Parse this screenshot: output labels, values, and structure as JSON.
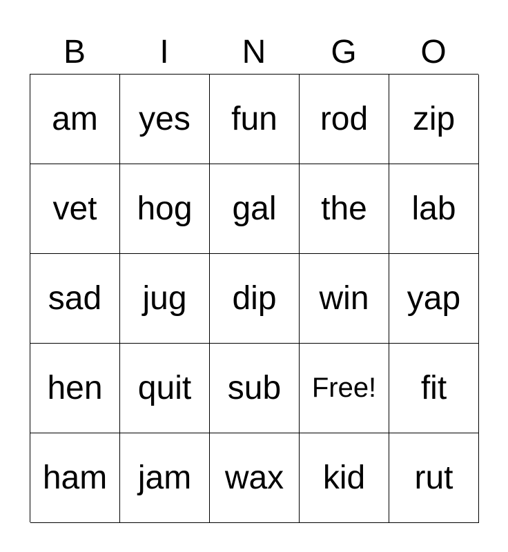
{
  "header": [
    "B",
    "I",
    "N",
    "G",
    "O"
  ],
  "cells": [
    [
      "am",
      "yes",
      "fun",
      "rod",
      "zip"
    ],
    [
      "vet",
      "hog",
      "gal",
      "the",
      "lab"
    ],
    [
      "sad",
      "jug",
      "dip",
      "win",
      "yap"
    ],
    [
      "hen",
      "quit",
      "sub",
      "Free!",
      "fit"
    ],
    [
      "ham",
      "jam",
      "wax",
      "kid",
      "rut"
    ]
  ]
}
